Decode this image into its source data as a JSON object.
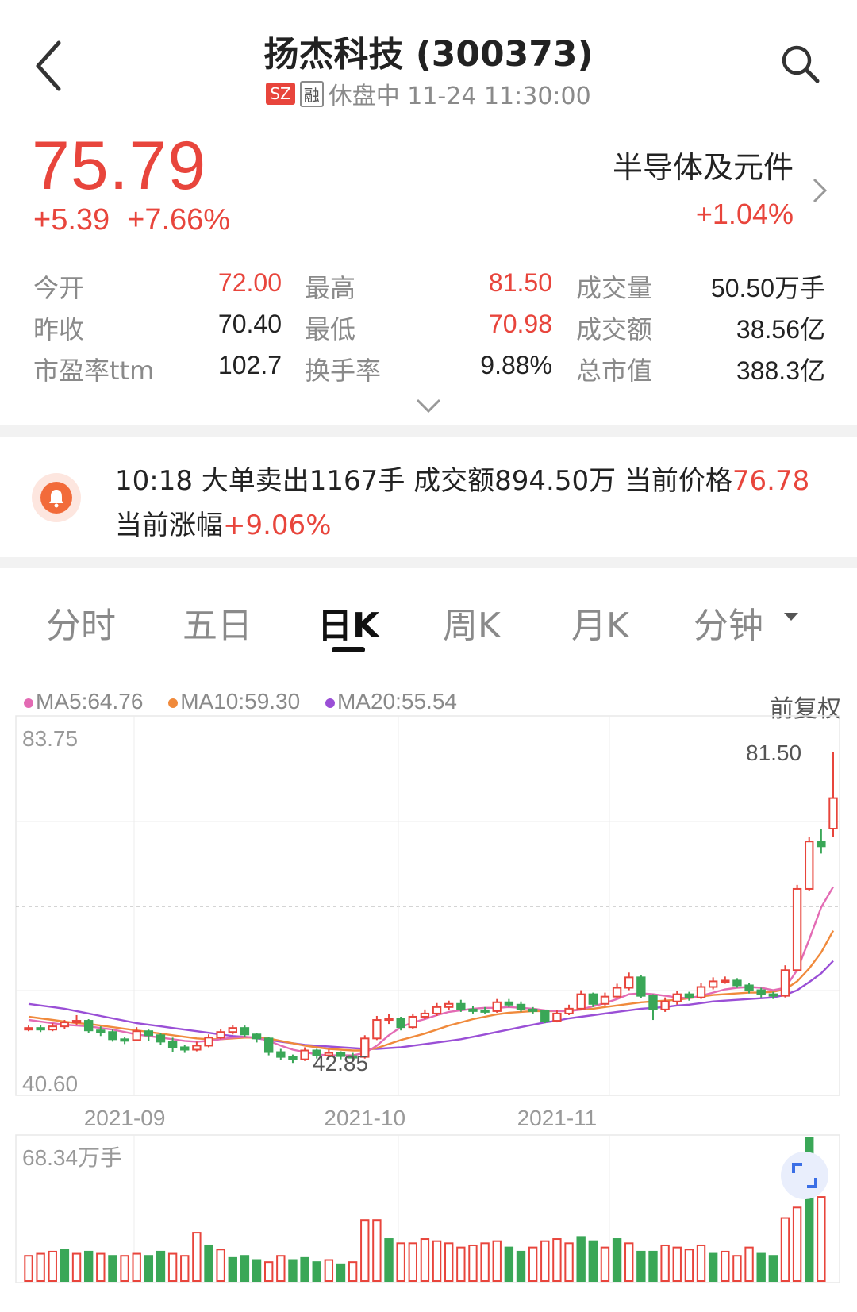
{
  "header": {
    "title": "扬杰科技 (300373)",
    "market_badge": "SZ",
    "margin_badge": "融",
    "status": "休盘中 11-24 11:30:00"
  },
  "quote": {
    "price": "75.79",
    "change": "+5.39",
    "change_pct": "+7.66%",
    "sector": "半导体及元件",
    "sector_pct": "+1.04%"
  },
  "stats": [
    {
      "l1": "今开",
      "v1": "72.00",
      "l2": "最高",
      "v2": "81.50",
      "l3": "成交量",
      "v3": "50.50万手"
    },
    {
      "l1": "昨收",
      "v1": "70.40",
      "l2": "最低",
      "v2": "70.98",
      "l3": "成交额",
      "v3": "38.56亿"
    },
    {
      "l1": "市盈率ttm",
      "v1": "102.7",
      "l2": "换手率",
      "v2": "9.88%",
      "l3": "总市值",
      "v3": "388.3亿"
    }
  ],
  "alert": {
    "line1_prefix": "10:18 大单卖出1167手 成交额894.50万 当前价格",
    "line1_price": "76.78",
    "line2_prefix": "当前涨幅",
    "line2_pct": "+9.06%"
  },
  "tabs": [
    "分时",
    "五日",
    "日K",
    "周K",
    "月K",
    "分钟"
  ],
  "active_tab": "日K",
  "ma_legend": {
    "ma5": "MA5:64.76",
    "ma10": "MA10:59.30",
    "ma20": "MA20:55.54"
  },
  "adjust_label": "前复权",
  "chart_labels": {
    "y_top": "83.75",
    "y_bottom": "40.60",
    "high_mark": "81.50",
    "low_mark": "42.85",
    "vol_max": "68.34万手"
  },
  "colors": {
    "up": "#e8453c",
    "down": "#3aa757",
    "ma5": "#e36bb4",
    "ma10": "#f08a3c",
    "ma20": "#9a4fd6"
  },
  "chart_data": {
    "type": "candlestick",
    "y_range": [
      40.6,
      83.75
    ],
    "volume_max": 68.34,
    "volume_unit": "万手",
    "x_ticks": [
      {
        "label": "2021-09",
        "index": 8
      },
      {
        "label": "2021-10",
        "index": 28
      },
      {
        "label": "2021-11",
        "index": 44
      }
    ],
    "candles": [
      [
        47.0,
        47.2,
        47.5,
        46.8
      ],
      [
        47.2,
        47.0,
        47.6,
        46.7
      ],
      [
        47.0,
        47.4,
        47.8,
        46.8
      ],
      [
        47.4,
        47.9,
        48.2,
        47.1
      ],
      [
        47.9,
        48.1,
        48.8,
        47.6
      ],
      [
        48.1,
        46.9,
        48.3,
        46.6
      ],
      [
        46.9,
        46.7,
        47.4,
        46.2
      ],
      [
        46.7,
        45.8,
        47.0,
        45.5
      ],
      [
        45.8,
        45.7,
        46.1,
        45.2
      ],
      [
        45.7,
        46.8,
        47.3,
        45.6
      ],
      [
        46.8,
        46.3,
        47.0,
        45.6
      ],
      [
        46.3,
        45.5,
        46.6,
        45.1
      ],
      [
        45.5,
        44.8,
        46.0,
        44.2
      ],
      [
        44.8,
        44.5,
        45.1,
        44.1
      ],
      [
        44.5,
        45.0,
        45.5,
        44.3
      ],
      [
        45.0,
        46.0,
        46.4,
        44.8
      ],
      [
        46.0,
        46.7,
        47.1,
        45.8
      ],
      [
        46.7,
        47.2,
        47.6,
        46.4
      ],
      [
        47.2,
        46.4,
        47.5,
        46.1
      ],
      [
        46.4,
        45.9,
        46.6,
        45.4
      ],
      [
        45.9,
        44.2,
        46.1,
        43.8
      ],
      [
        44.2,
        43.6,
        44.6,
        43.2
      ],
      [
        43.6,
        43.3,
        43.9,
        42.85
      ],
      [
        43.3,
        44.4,
        44.8,
        43.1
      ],
      [
        44.4,
        43.8,
        44.6,
        43.4
      ],
      [
        43.8,
        44.1,
        44.5,
        43.6
      ],
      [
        44.1,
        43.7,
        44.3,
        43.3
      ],
      [
        43.7,
        43.6,
        44.1,
        43.3
      ],
      [
        43.6,
        45.9,
        46.3,
        43.4
      ],
      [
        45.9,
        48.2,
        48.7,
        45.7
      ],
      [
        48.2,
        48.4,
        48.9,
        47.7
      ],
      [
        48.4,
        47.3,
        48.6,
        46.9
      ],
      [
        47.3,
        48.6,
        49.0,
        47.1
      ],
      [
        48.6,
        49.0,
        49.5,
        48.3
      ],
      [
        49.0,
        49.8,
        50.3,
        48.7
      ],
      [
        49.8,
        50.2,
        50.6,
        49.4
      ],
      [
        50.2,
        49.5,
        50.7,
        49.2
      ],
      [
        49.5,
        49.4,
        49.9,
        49.0
      ],
      [
        49.4,
        49.3,
        49.8,
        49.0
      ],
      [
        49.3,
        50.4,
        50.8,
        49.1
      ],
      [
        50.4,
        50.1,
        50.8,
        49.8
      ],
      [
        50.1,
        49.5,
        50.5,
        49.2
      ],
      [
        49.5,
        49.3,
        49.8,
        49.0
      ],
      [
        49.3,
        48.1,
        49.4,
        47.8
      ],
      [
        48.1,
        49.0,
        49.4,
        47.9
      ],
      [
        49.0,
        49.6,
        50.1,
        48.8
      ],
      [
        49.6,
        51.4,
        51.9,
        49.4
      ],
      [
        51.4,
        50.2,
        51.6,
        49.8
      ],
      [
        50.2,
        51.1,
        51.6,
        50.0
      ],
      [
        51.1,
        52.2,
        52.7,
        50.9
      ],
      [
        52.2,
        53.5,
        54.1,
        51.9
      ],
      [
        53.5,
        51.2,
        53.8,
        50.9
      ],
      [
        51.2,
        49.5,
        51.4,
        48.2
      ],
      [
        49.5,
        50.5,
        51.0,
        49.2
      ],
      [
        50.5,
        51.4,
        51.8,
        50.1
      ],
      [
        51.4,
        51.0,
        51.7,
        50.6
      ],
      [
        51.0,
        52.3,
        52.8,
        50.8
      ],
      [
        52.3,
        53.0,
        53.5,
        52.0
      ],
      [
        53.0,
        53.1,
        53.6,
        52.7
      ],
      [
        53.1,
        52.5,
        53.4,
        52.2
      ],
      [
        52.5,
        51.9,
        52.8,
        51.5
      ],
      [
        51.9,
        51.4,
        52.2,
        51.0
      ],
      [
        51.4,
        51.2,
        51.7,
        50.8
      ],
      [
        51.2,
        54.4,
        55.0,
        51.0
      ],
      [
        54.4,
        64.5,
        65.0,
        54.2
      ],
      [
        64.5,
        70.4,
        70.98,
        64.2
      ],
      [
        70.4,
        69.8,
        72.0,
        68.9
      ],
      [
        72.0,
        75.79,
        81.5,
        70.98
      ]
    ],
    "volumes": [
      [
        12,
        1
      ],
      [
        13,
        1
      ],
      [
        14,
        1
      ],
      [
        15,
        0
      ],
      [
        13,
        1
      ],
      [
        14,
        0
      ],
      [
        13,
        1
      ],
      [
        12,
        0
      ],
      [
        12,
        1
      ],
      [
        13,
        1
      ],
      [
        12,
        0
      ],
      [
        14,
        0
      ],
      [
        13,
        1
      ],
      [
        12,
        1
      ],
      [
        23,
        1
      ],
      [
        17,
        0
      ],
      [
        15,
        1
      ],
      [
        11,
        0
      ],
      [
        12,
        0
      ],
      [
        10,
        0
      ],
      [
        9,
        1
      ],
      [
        12,
        1
      ],
      [
        10,
        0
      ],
      [
        11,
        0
      ],
      [
        9,
        0
      ],
      [
        10,
        1
      ],
      [
        8,
        0
      ],
      [
        9,
        1
      ],
      [
        29,
        1
      ],
      [
        29,
        1
      ],
      [
        20,
        0
      ],
      [
        18,
        1
      ],
      [
        18,
        1
      ],
      [
        20,
        1
      ],
      [
        19,
        1
      ],
      [
        18,
        1
      ],
      [
        16,
        1
      ],
      [
        17,
        1
      ],
      [
        18,
        1
      ],
      [
        19,
        1
      ],
      [
        16,
        0
      ],
      [
        14,
        0
      ],
      [
        16,
        1
      ],
      [
        19,
        1
      ],
      [
        20,
        1
      ],
      [
        18,
        1
      ],
      [
        21,
        0
      ],
      [
        19,
        0
      ],
      [
        16,
        1
      ],
      [
        20,
        0
      ],
      [
        18,
        1
      ],
      [
        14,
        0
      ],
      [
        14,
        0
      ],
      [
        17,
        1
      ],
      [
        16,
        1
      ],
      [
        15,
        1
      ],
      [
        17,
        1
      ],
      [
        13,
        0
      ],
      [
        14,
        1
      ],
      [
        12,
        1
      ],
      [
        16,
        1
      ],
      [
        13,
        0
      ],
      [
        12,
        0
      ],
      [
        30,
        1
      ],
      [
        35,
        1
      ],
      [
        68.34,
        0
      ],
      [
        40,
        1
      ]
    ],
    "ma5": [
      48.2,
      48.0,
      47.8,
      47.6,
      47.5,
      47.4,
      47.2,
      47.0,
      46.7,
      46.4,
      46.2,
      46.0,
      45.8,
      45.6,
      45.5,
      45.6,
      45.8,
      46.0,
      46.1,
      46.0,
      45.6,
      45.0,
      44.5,
      44.2,
      43.9,
      43.8,
      43.8,
      43.8,
      44.1,
      45.0,
      46.3,
      47.3,
      47.9,
      48.3,
      48.8,
      49.2,
      49.4,
      49.6,
      49.7,
      49.7,
      49.8,
      49.7,
      49.6,
      49.4,
      49.3,
      49.3,
      49.5,
      49.9,
      50.3,
      50.8,
      51.4,
      51.5,
      51.4,
      51.2,
      51.0,
      50.9,
      51.2,
      51.6,
      52.0,
      52.2,
      52.3,
      52.2,
      51.9,
      52.2,
      54.4,
      58.2,
      62.2,
      64.76
    ],
    "ma10": [
      48.6,
      48.4,
      48.2,
      48.0,
      47.8,
      47.7,
      47.5,
      47.3,
      47.1,
      46.9,
      46.7,
      46.5,
      46.3,
      46.1,
      45.9,
      45.8,
      45.8,
      45.9,
      46.0,
      46.0,
      45.9,
      45.6,
      45.3,
      45.0,
      44.8,
      44.6,
      44.5,
      44.4,
      44.4,
      44.7,
      45.2,
      45.7,
      46.1,
      46.5,
      47.0,
      47.5,
      47.9,
      48.3,
      48.6,
      48.9,
      49.1,
      49.2,
      49.3,
      49.3,
      49.3,
      49.4,
      49.5,
      49.6,
      49.8,
      50.0,
      50.2,
      50.4,
      50.5,
      50.6,
      50.7,
      50.9,
      51.1,
      51.3,
      51.4,
      51.5,
      51.6,
      51.6,
      51.7,
      52.0,
      53.0,
      54.6,
      56.6,
      59.3
    ],
    "ma20": [
      50.2,
      50.0,
      49.8,
      49.6,
      49.3,
      49.0,
      48.7,
      48.4,
      48.1,
      47.8,
      47.6,
      47.4,
      47.2,
      47.0,
      46.8,
      46.6,
      46.4,
      46.2,
      46.1,
      45.9,
      45.7,
      45.5,
      45.3,
      45.1,
      45.0,
      44.9,
      44.8,
      44.7,
      44.6,
      44.6,
      44.7,
      44.8,
      45.0,
      45.2,
      45.4,
      45.6,
      45.8,
      46.1,
      46.4,
      46.7,
      47.0,
      47.3,
      47.6,
      47.9,
      48.1,
      48.4,
      48.6,
      48.8,
      49.0,
      49.2,
      49.4,
      49.6,
      49.7,
      49.8,
      50.0,
      50.1,
      50.3,
      50.5,
      50.6,
      50.7,
      50.8,
      50.9,
      51.0,
      51.3,
      51.9,
      52.9,
      54.0,
      55.54
    ]
  }
}
